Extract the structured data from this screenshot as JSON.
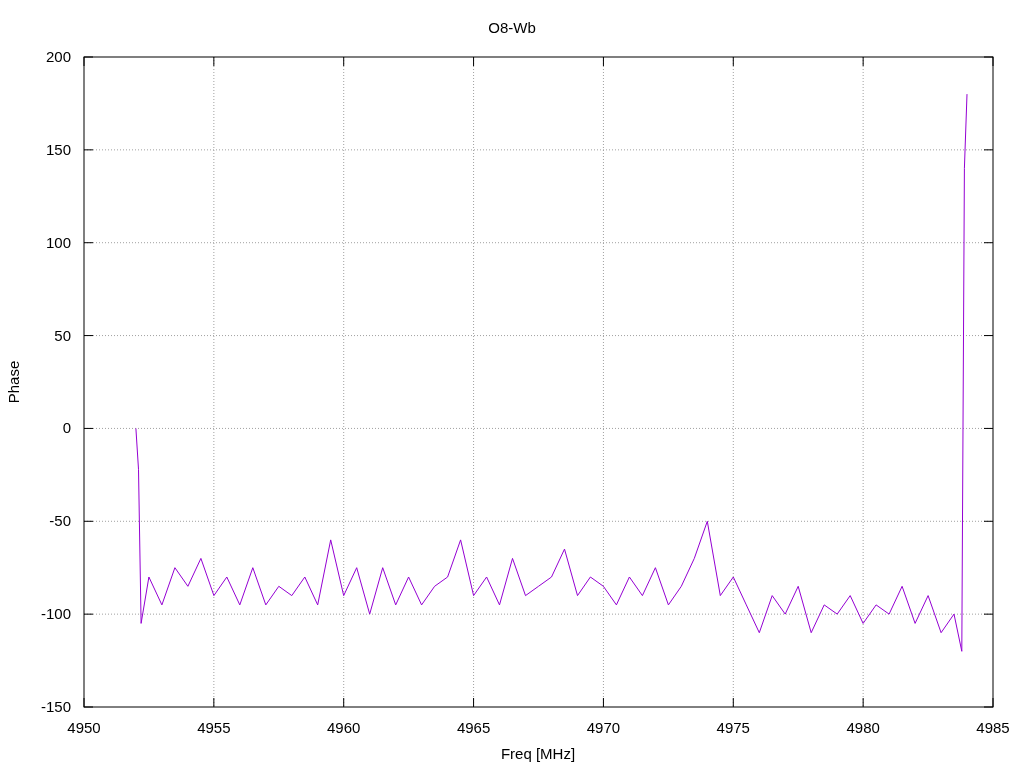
{
  "chart_data": {
    "type": "line",
    "title": "O8-Wb",
    "xlabel": "Freq [MHz]",
    "ylabel": "Phase",
    "grid": true,
    "xlim": [
      4950,
      4985
    ],
    "ylim": [
      -150,
      200
    ],
    "xticks": [
      4950,
      4955,
      4960,
      4965,
      4970,
      4975,
      4980,
      4985
    ],
    "yticks": [
      -150,
      -100,
      -50,
      0,
      50,
      100,
      150,
      200
    ],
    "x": [
      4952.0,
      4952.1,
      4952.2,
      4952.5,
      4953,
      4953.5,
      4954,
      4954.5,
      4955,
      4955.5,
      4956,
      4956.5,
      4957,
      4957.5,
      4958,
      4958.5,
      4959,
      4959.5,
      4960,
      4960.5,
      4961,
      4961.5,
      4962,
      4962.5,
      4963,
      4963.5,
      4964,
      4964.5,
      4965,
      4965.5,
      4966,
      4966.5,
      4967,
      4967.5,
      4968,
      4968.5,
      4969,
      4969.5,
      4970,
      4970.5,
      4971,
      4971.5,
      4972,
      4972.5,
      4973,
      4973.5,
      4974,
      4974.5,
      4975,
      4975.5,
      4976,
      4976.5,
      4977,
      4977.5,
      4978,
      4978.5,
      4979,
      4979.5,
      4980,
      4980.5,
      4981,
      4981.5,
      4982,
      4982.5,
      4983,
      4983.5,
      4983.8,
      4983.9,
      4984.0
    ],
    "series": [
      {
        "color": "#9400d3",
        "values": [
          0,
          -22,
          -105,
          -80,
          -95,
          -75,
          -85,
          -70,
          -90,
          -80,
          -95,
          -75,
          -95,
          -85,
          -90,
          -80,
          -95,
          -60,
          -90,
          -75,
          -100,
          -75,
          -95,
          -80,
          -95,
          -85,
          -80,
          -60,
          -90,
          -80,
          -95,
          -70,
          -90,
          -85,
          -80,
          -65,
          -90,
          -80,
          -85,
          -95,
          -80,
          -90,
          -75,
          -95,
          -85,
          -70,
          -50,
          -90,
          -80,
          -95,
          -110,
          -90,
          -100,
          -85,
          -110,
          -95,
          -100,
          -90,
          -105,
          -95,
          -100,
          -85,
          -105,
          -90,
          -110,
          -100,
          -120,
          140,
          180
        ]
      }
    ]
  }
}
